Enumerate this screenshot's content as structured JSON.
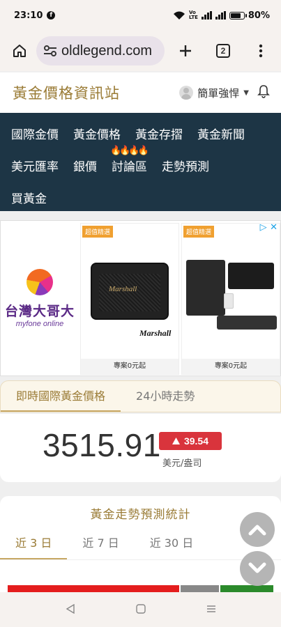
{
  "status": {
    "time": "23:10",
    "network": "VoLTE",
    "battery": "80%"
  },
  "browser": {
    "url": "oldlegend.com",
    "tab_count": "2"
  },
  "site": {
    "title": "黃金價格資訊站",
    "user_name": "簡單強悍"
  },
  "nav": {
    "row1": [
      "國際金價",
      "黃金價格",
      "黃金存摺",
      "黃金新聞"
    ],
    "row2": [
      "美元匯率",
      "銀價",
      "討論區",
      "走勢預測"
    ],
    "row3": [
      "買黃金"
    ]
  },
  "ad": {
    "brand_name": "台灣大哥大",
    "brand_sub": "myfone online",
    "cards": [
      {
        "tag": "超值精選",
        "caption": "專案0元起",
        "product_brand": "Marshall"
      },
      {
        "tag": "超值精選",
        "caption": "專案0元起"
      }
    ]
  },
  "price": {
    "tab_active": "即時國際黃金價格",
    "tab_other": "24小時走勢",
    "value": "3515.91",
    "change": "39.54",
    "unit": "美元/盎司"
  },
  "forecast": {
    "title": "黃金走勢預測統計",
    "tabs": [
      "近 3 日",
      "近 7 日",
      "近 30 日"
    ]
  },
  "colors": {
    "gold": "#9a7b35",
    "nav_bg": "#1d3545",
    "up_red": "#d9343c",
    "bar_red": "#e41d1d",
    "bar_green": "#2b8a2b"
  }
}
